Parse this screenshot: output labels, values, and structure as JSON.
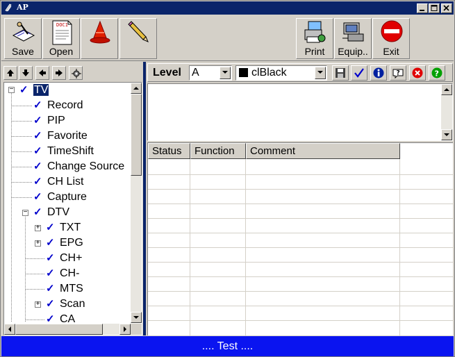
{
  "window": {
    "title": "AP"
  },
  "toolbar": {
    "save_label": "Save",
    "open_label": "Open",
    "open_doc_text": "DOC1",
    "print_label": "Print",
    "equip_label": "Equip..",
    "exit_label": "Exit"
  },
  "tree": {
    "nodes": [
      {
        "label": "TV",
        "checked": true,
        "selected": true
      },
      {
        "label": "Record",
        "checked": true
      },
      {
        "label": "PIP",
        "checked": true
      },
      {
        "label": "Favorite",
        "checked": true
      },
      {
        "label": "TimeShift",
        "checked": true
      },
      {
        "label": "Change Source",
        "checked": true
      },
      {
        "label": "CH List",
        "checked": true
      },
      {
        "label": "Capture",
        "checked": true
      },
      {
        "label": "DTV",
        "checked": true
      },
      {
        "label": "TXT",
        "checked": true
      },
      {
        "label": "EPG",
        "checked": true
      },
      {
        "label": "CH+",
        "checked": true
      },
      {
        "label": "CH-",
        "checked": true
      },
      {
        "label": "MTS",
        "checked": true
      },
      {
        "label": "Scan",
        "checked": true
      },
      {
        "label": "CA",
        "checked": true
      }
    ],
    "check_glyph": "✓"
  },
  "editor": {
    "level_label": "Level",
    "level_value": "A",
    "color_value": "clBlack"
  },
  "grid": {
    "columns": [
      "Status",
      "Function",
      "Comment"
    ],
    "rows": []
  },
  "status": {
    "text": ".... Test ...."
  },
  "colors": {
    "titlebar": "#0a246a",
    "statusbar": "#0a14f0",
    "check": "#0000cc",
    "face": "#d4d0c8"
  },
  "icons": {
    "save": "save-icon",
    "open": "open-document-icon",
    "cone": "traffic-cone-icon",
    "pencil": "pencil-icon",
    "print": "printer-icon",
    "equip": "equipment-icon",
    "exit": "exit-icon"
  }
}
